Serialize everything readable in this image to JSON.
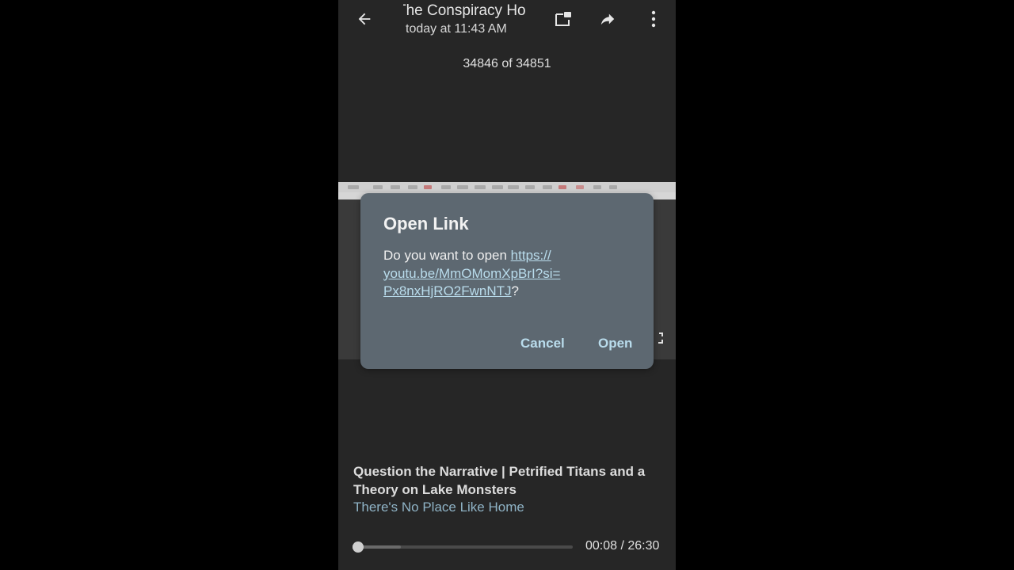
{
  "header": {
    "title": "The Conspiracy Ho",
    "subtitle": "today at 11:43 AM",
    "icons": [
      "back-arrow-icon",
      "picture-in-picture-icon",
      "share-icon",
      "more-vert-icon"
    ]
  },
  "counter": "34846 of 34851",
  "dialog": {
    "title": "Open Link",
    "prompt": "Do you want to open ",
    "url": "https://youtu.be/MmOMomXpBrI?si=Px8nxHjRO2FwnNTJ",
    "url_line1": "https://",
    "url_line2": "youtu.be/MmOMomXpBrI?si=",
    "url_line3": "Px8nxHjRO2FwnNTJ",
    "suffix": "?",
    "cancel_label": "Cancel",
    "open_label": "Open"
  },
  "video": {
    "title": "Question the Narrative | Petrified Titans and a Theory on Lake Monsters",
    "channel": "There's No Place Like Home",
    "current_time": "00:08",
    "duration": "26:30",
    "time_display": "00:08 / 26:30",
    "progress_fraction": 0.005,
    "buffered_fraction": 0.22
  },
  "colors": {
    "background": "#262626",
    "dialog": "#5d6871",
    "accent": "#b9dcec",
    "channel": "#8fb3c6"
  }
}
